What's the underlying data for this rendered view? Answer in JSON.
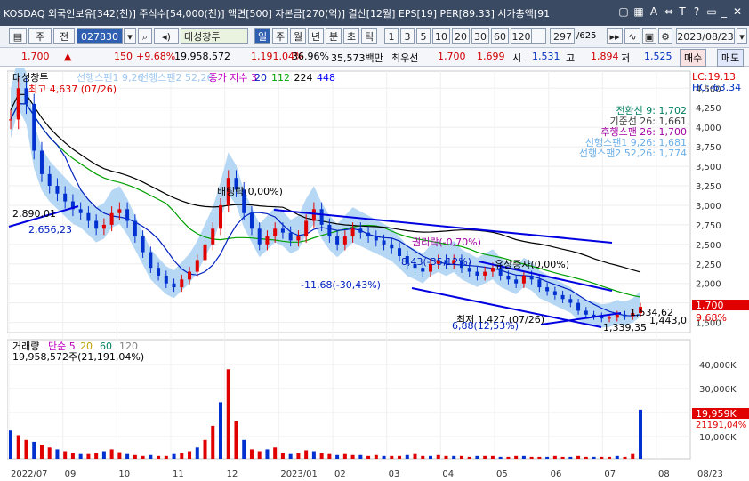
{
  "titlebar": {
    "text": "KOSDAQ 외국인보유[342(천)] 주식수[54,000(천)] 액면[500] 자본금[270(억)] 결산[12월] EPS[19] PER[89.33] 시가총액[91"
  },
  "toolbar": {
    "period_a": "주",
    "period_b": "전",
    "code": "027830",
    "stock_name": "대성창투",
    "periods": [
      "일",
      "주",
      "월",
      "년",
      "분",
      "초",
      "틱"
    ],
    "numbers": [
      "1",
      "3",
      "5",
      "10",
      "20",
      "30",
      "60",
      "120"
    ],
    "count": "297",
    "total": "/625",
    "date": "2023/08/23"
  },
  "infobar": {
    "price": "1,700",
    "change": "150",
    "change_pct": "+9.68%",
    "volume": "19,958,572",
    "volume_pct": "1,191.04%",
    "turnover": "36.96%",
    "amount": "35,573백만",
    "best_ask_label": "최우선",
    "best_ask": "1,700",
    "best_bid": "1,699",
    "open_label": "시",
    "open": "1,531",
    "high_label": "고",
    "high": "1,894",
    "low_label": "저",
    "low": "1,525",
    "sell_label": "매수",
    "buy_label": "매도"
  },
  "chart_data": {
    "type": "line",
    "price_panel": {
      "title": "대성창투",
      "legend": [
        {
          "name": "선행스팬1 9,26",
          "color": "#9ec7f0"
        },
        {
          "name": "선행스팬2 52,26",
          "color": "#9ec7f0"
        },
        {
          "name": "종가 지수 3",
          "color": "#c000c0"
        },
        {
          "name": "20",
          "color": "#0020c0"
        },
        {
          "name": "112",
          "color": "#00a000"
        },
        {
          "name": "224",
          "color": "#000000"
        },
        {
          "name": "448",
          "color": "#0000ff"
        }
      ],
      "max_label": "최고 4,637 (07/26)",
      "corner_labels": [
        "LC:19.13",
        "HC:-63.34"
      ],
      "ichimoku_labels": [
        {
          "text": "전환선 9: 1,702",
          "color": "#008060"
        },
        {
          "text": "기준선 26: 1,661",
          "color": "#404040"
        },
        {
          "text": "후행스팬 26: 1,700",
          "color": "#a000a0"
        },
        {
          "text": "선행스팬1 9,26: 1,681",
          "color": "#6aaee8"
        },
        {
          "text": "선행스팬2 52,26: 1,774",
          "color": "#6aaee8"
        }
      ],
      "annotations": [
        {
          "text": "2,890,01",
          "color": "#000"
        },
        {
          "text": "2,656,23",
          "color": "#0020c0"
        },
        {
          "text": "배팅락(0,00%)",
          "color": "#000"
        },
        {
          "text": "권리락(-0,70%)",
          "color": "#a000a0"
        },
        {
          "text": "8,43(-35,12%)",
          "color": "#0020c0"
        },
        {
          "text": "유상증자(0,00%)",
          "color": "#000"
        },
        {
          "text": "-11,68(-30,43%)",
          "color": "#0020c0"
        },
        {
          "text": "최저 1,427 (07/26)",
          "color": "#000"
        },
        {
          "text": "6,88(12,53%)",
          "color": "#0020c0"
        },
        {
          "text": "1,534,62",
          "color": "#000"
        },
        {
          "text": "1,443,0",
          "color": "#000"
        },
        {
          "text": "1,339,35",
          "color": "#000"
        }
      ],
      "yticks": [
        4500,
        4250,
        4000,
        3750,
        3500,
        3250,
        3000,
        2750,
        2500,
        2250,
        2000,
        1750,
        1500
      ],
      "ylim": [
        1370,
        4720
      ],
      "current_price": "1,700",
      "current_pct": "9.68%",
      "close": [
        4100,
        4500,
        4300,
        3700,
        3400,
        3250,
        3150,
        3050,
        2950,
        2900,
        2800,
        2700,
        2750,
        2900,
        2950,
        2800,
        2600,
        2400,
        2200,
        2100,
        2000,
        1950,
        2050,
        2150,
        2300,
        2500,
        2700,
        3000,
        3350,
        3200,
        2900,
        2700,
        2500,
        2600,
        2700,
        2650,
        2550,
        2600,
        2800,
        2950,
        2750,
        2600,
        2500,
        2600,
        2700,
        2650,
        2600,
        2550,
        2500,
        2450,
        2350,
        2250,
        2200,
        2150,
        2250,
        2300,
        2250,
        2300,
        2200,
        2150,
        2100,
        2150,
        2200,
        2100,
        2050,
        2000,
        2100,
        2050,
        1950,
        1900,
        1850,
        1800,
        1750,
        1650,
        1600,
        1580,
        1550,
        1560,
        1600,
        1580,
        1620,
        1700
      ]
    },
    "volume_panel": {
      "title": "거래량",
      "legend": [
        {
          "name": "단순 5",
          "color": "#c000c0"
        },
        {
          "name": "20",
          "color": "#c0a000"
        },
        {
          "name": "60",
          "color": "#008060"
        },
        {
          "name": "120",
          "color": "#808080"
        }
      ],
      "header": "19,958,572주(21,191,04%)",
      "yticks": [
        "40,000K",
        "30,000K",
        "20,000K",
        "10,000K"
      ],
      "current": "19,959K",
      "current_pct": "21191,04%"
    },
    "xaxis": [
      "2022/07",
      "09",
      "10",
      "11",
      "12",
      "2023/01",
      "02",
      "03",
      "04",
      "05",
      "06",
      "07",
      "08",
      "08/23"
    ]
  }
}
